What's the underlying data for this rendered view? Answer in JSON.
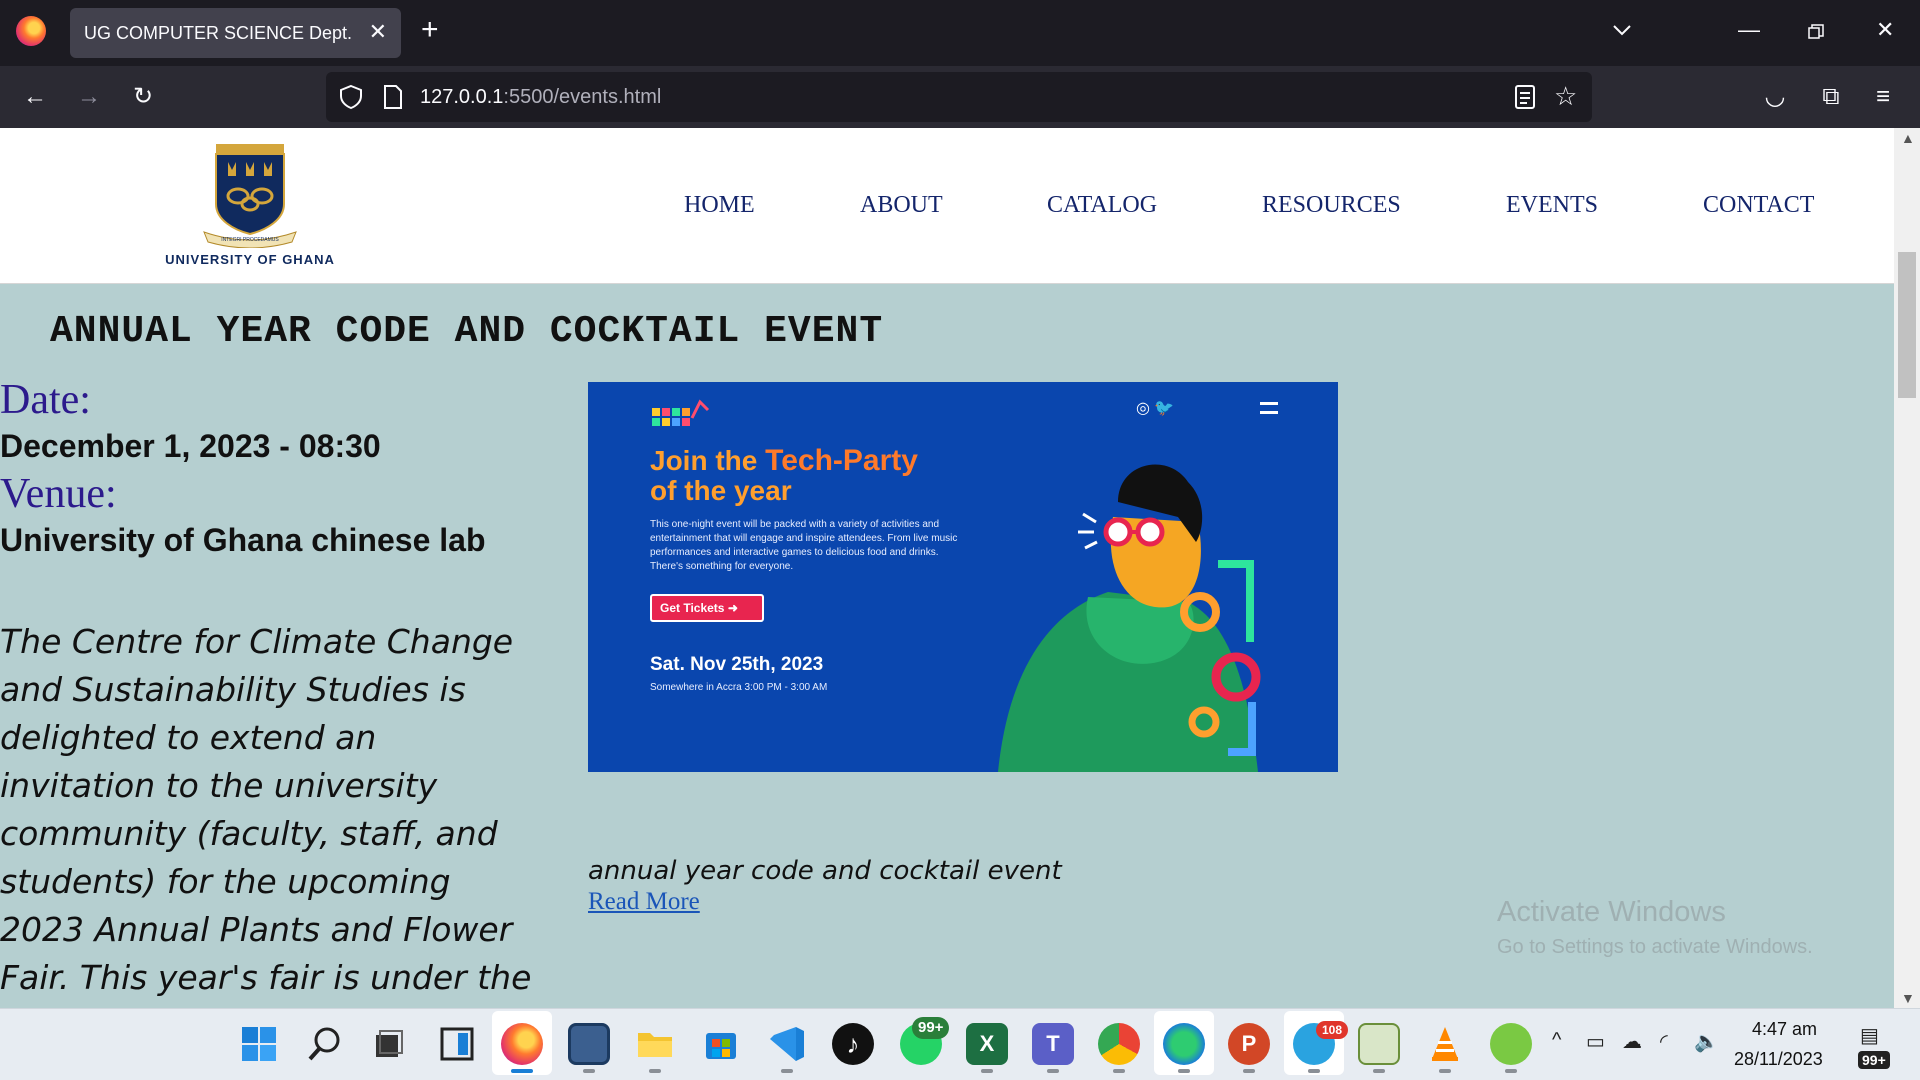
{
  "browser": {
    "tab_title": "UG COMPUTER SCIENCE Dept.",
    "url_host": "127.0.0.1",
    "url_path": ":5500/events.html"
  },
  "site": {
    "logo_text": "UNIVERSITY OF GHANA",
    "crest_motto": "INTEGRI PROCEDAMUS",
    "nav": [
      "HOME",
      "ABOUT",
      "CATALOG",
      "RESOURCES",
      "EVENTS",
      "CONTACT"
    ]
  },
  "event": {
    "title": "ANNUAL YEAR CODE AND COCKTAIL EVENT",
    "date_label": "Date:",
    "date_value": "December 1, 2023 - 08:30",
    "venue_label": "Venue:",
    "venue_value": "University of Ghana chinese lab",
    "description": "The Centre for Climate Change and Sustainability Studies is delighted to extend an invitation to the university community (faculty, staff, and students) for the upcoming 2023 Annual Plants and Flower Fair. This year's fair is under the theme “Change the",
    "caption": "annual year code and cocktail event",
    "read_more": "Read More"
  },
  "poster": {
    "headline_1": "Join the",
    "headline_accent": "Tech-Party",
    "headline_2": "of the year",
    "body": "This one-night event will be packed with a variety of activities and entertainment that will engage and inspire attendees. From live music performances and interactive games to delicious food and drinks. There's something for everyone.",
    "button": "Get Tickets",
    "date": "Sat. Nov 25th, 2023",
    "place": "Somewhere in Accra     3:00 PM - 3:00 AM"
  },
  "watermark": {
    "line1": "Activate Windows",
    "line2": "Go to Settings to activate Windows."
  },
  "taskbar": {
    "whatsapp_badge": "99+",
    "telegram_badge": "108",
    "time": "4:47 am",
    "date": "28/11/2023",
    "notifications": "99+"
  },
  "colors": {
    "page_bg": "#b5cfd0",
    "nav_link": "#14256b",
    "label": "#2c1a8c",
    "poster_bg": "#0a46ae",
    "link": "#1a55b8"
  }
}
